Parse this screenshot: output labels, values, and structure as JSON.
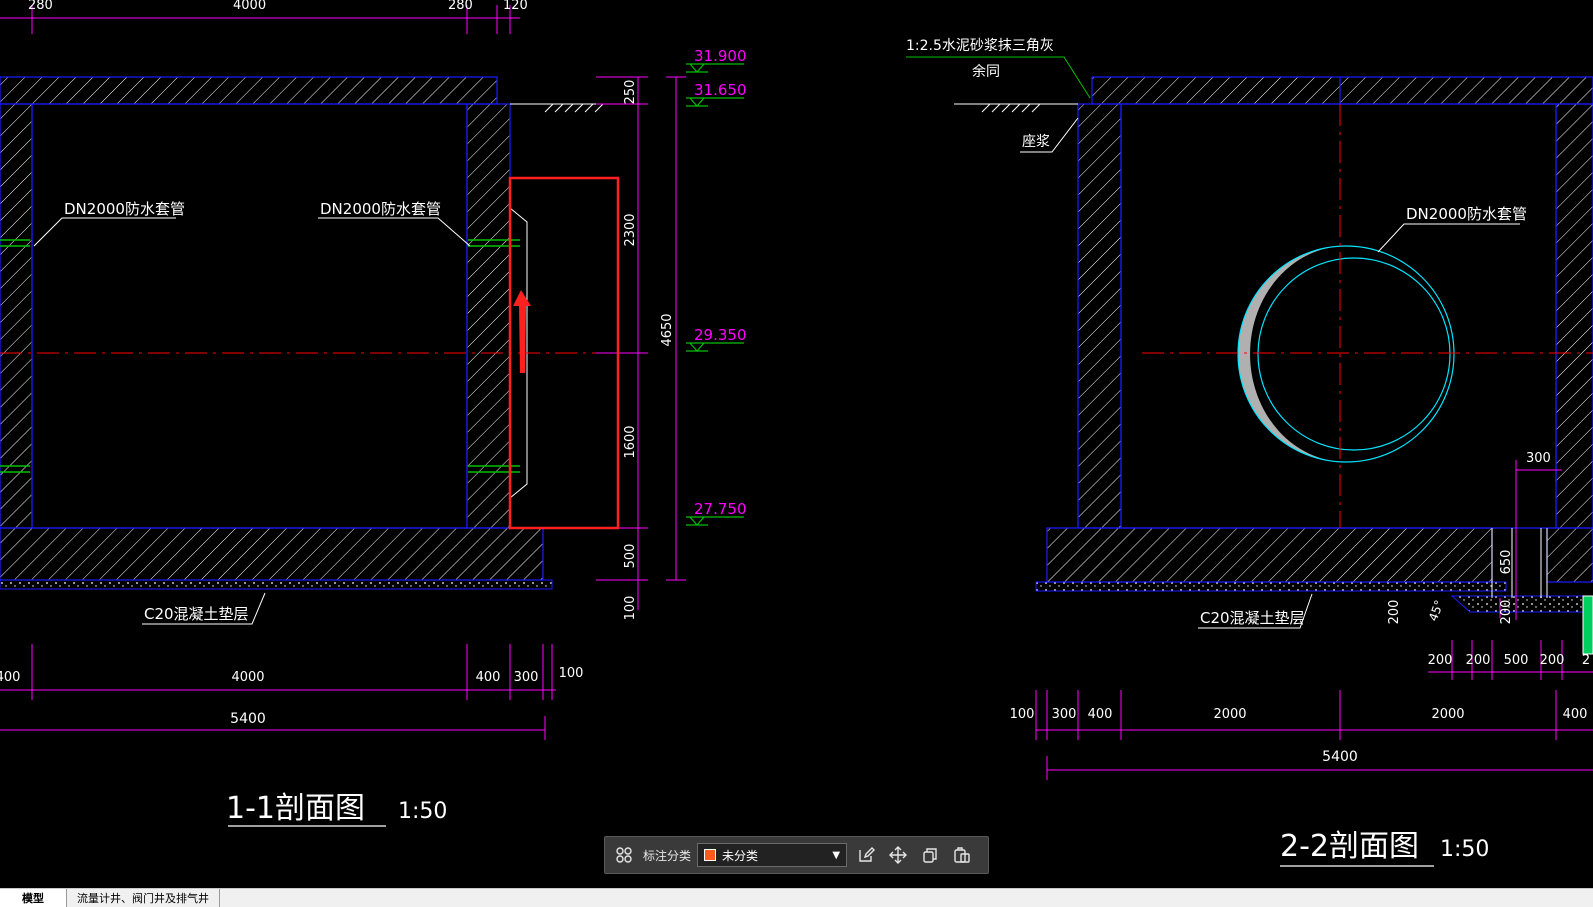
{
  "colors": {
    "background": "#000000",
    "outline": "#1a1aff",
    "dimension": "#ff00ff",
    "elevation": "#00c000",
    "centerline": "#ff0000",
    "text": "#ffffff",
    "highlight": "#ff2020",
    "pipe": "#00e5ff"
  },
  "drawing": {
    "left_section": {
      "top_dims": [
        "280",
        "4000",
        "280",
        "120"
      ],
      "labels": {
        "pipe_left": "DN2000防水套管",
        "pipe_right": "DN2000防水套管",
        "cushion": "C20混凝土垫层"
      },
      "elevations": [
        "31.900",
        "31.650",
        "29.350",
        "27.750"
      ],
      "right_dims": [
        "250",
        "2300",
        "1600",
        "500",
        "100"
      ],
      "total_height": "4650",
      "bottom_dims": [
        "400",
        "4000",
        "400",
        "300",
        "100"
      ],
      "bottom_total": "5400",
      "title": "1-1剖面图",
      "scale": "1:50"
    },
    "right_section": {
      "note_line1": "1:2.5水泥砂浆抹三角灰",
      "note_line2": "余同",
      "mortar": "座浆",
      "pipe": "DN2000防水套管",
      "cushion": "C20混凝土垫层",
      "sump_dims": [
        "300",
        "650",
        "200",
        "200",
        "45°"
      ],
      "bottom_dims_small": [
        "200",
        "200",
        "500",
        "200",
        "2"
      ],
      "bottom_dims": [
        "100",
        "300",
        "400",
        "2000",
        "2000",
        "400"
      ],
      "bottom_total": "5400",
      "title": "2-2剖面图",
      "scale": "1:50"
    }
  },
  "toolbar": {
    "label": "标注分类",
    "selected": "未分类",
    "swatch_color": "#ff5a1f"
  },
  "tabs": [
    "模型",
    "流量计井、阀门井及排气井"
  ]
}
